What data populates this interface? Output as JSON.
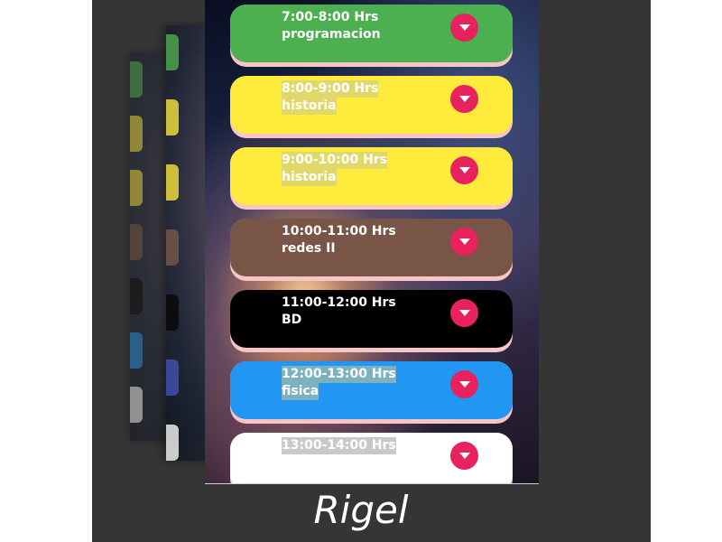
{
  "caption": "Rigel",
  "schedule": [
    {
      "time": "7:00-8:00 Hrs",
      "subject": "programacion",
      "color": "#4caf50"
    },
    {
      "time": "8:00-9:00 Hrs",
      "subject": "historia",
      "color": "#ffeb3b"
    },
    {
      "time": "9:00-10:00 Hrs",
      "subject": "historia",
      "color": "#ffeb3b"
    },
    {
      "time": "10:00-11:00 Hrs",
      "subject": "redes II",
      "color": "#795548"
    },
    {
      "time": "11:00-12:00 Hrs",
      "subject": "BD",
      "color": "#000000"
    },
    {
      "time": "12:00-13:00 Hrs",
      "subject": "fisica",
      "color": "#2196f3"
    },
    {
      "time": "13:00-14:00 Hrs",
      "subject": "",
      "color": "#ffffff"
    }
  ],
  "colors": {
    "backdrop": "#353535",
    "slot_shadow": "#f7c5c5",
    "button": "#e8215f"
  },
  "icons": {
    "expand": "chevron-down-icon"
  }
}
